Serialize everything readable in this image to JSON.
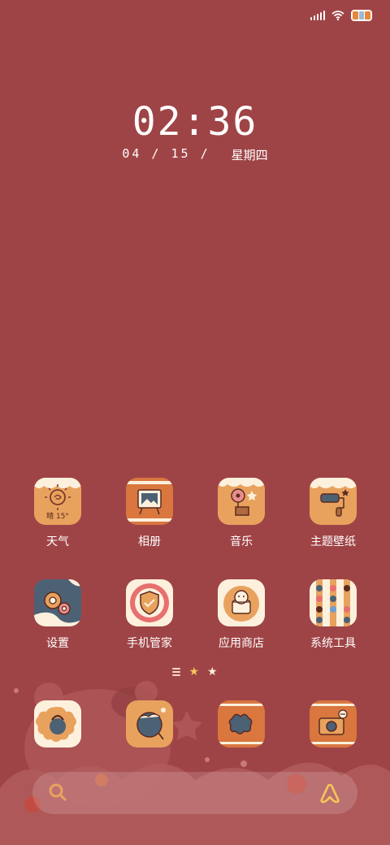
{
  "status": {
    "icons": [
      "signal-icon",
      "wifi-icon",
      "battery-icon"
    ],
    "battery_colors": [
      "#e8863b",
      "#9fb8d6",
      "#e8863b"
    ]
  },
  "lockscreen": {
    "time": "02:36",
    "date": "04 / 15 /",
    "weekday": "星期四"
  },
  "apps_row1": [
    {
      "label": "天气",
      "icon": "weather-icon",
      "icon_text": "晴 15°"
    },
    {
      "label": "相册",
      "icon": "gallery-icon"
    },
    {
      "label": "音乐",
      "icon": "music-icon"
    },
    {
      "label": "主题壁纸",
      "icon": "theme-icon"
    }
  ],
  "apps_row2": [
    {
      "label": "设置",
      "icon": "settings-icon"
    },
    {
      "label": "手机管家",
      "icon": "security-icon"
    },
    {
      "label": "应用商店",
      "icon": "app-store-icon"
    },
    {
      "label": "系统工具",
      "icon": "tools-icon"
    }
  ],
  "dock": [
    {
      "icon": "phone-icon"
    },
    {
      "icon": "messages-icon"
    },
    {
      "icon": "browser-icon"
    },
    {
      "icon": "camera-icon"
    }
  ],
  "colors": {
    "background": "#9f4446",
    "icon_orange": "#e8a25e",
    "icon_cream": "#fdf1de",
    "icon_slate": "#4d6175",
    "icon_rust": "#d9773f"
  }
}
